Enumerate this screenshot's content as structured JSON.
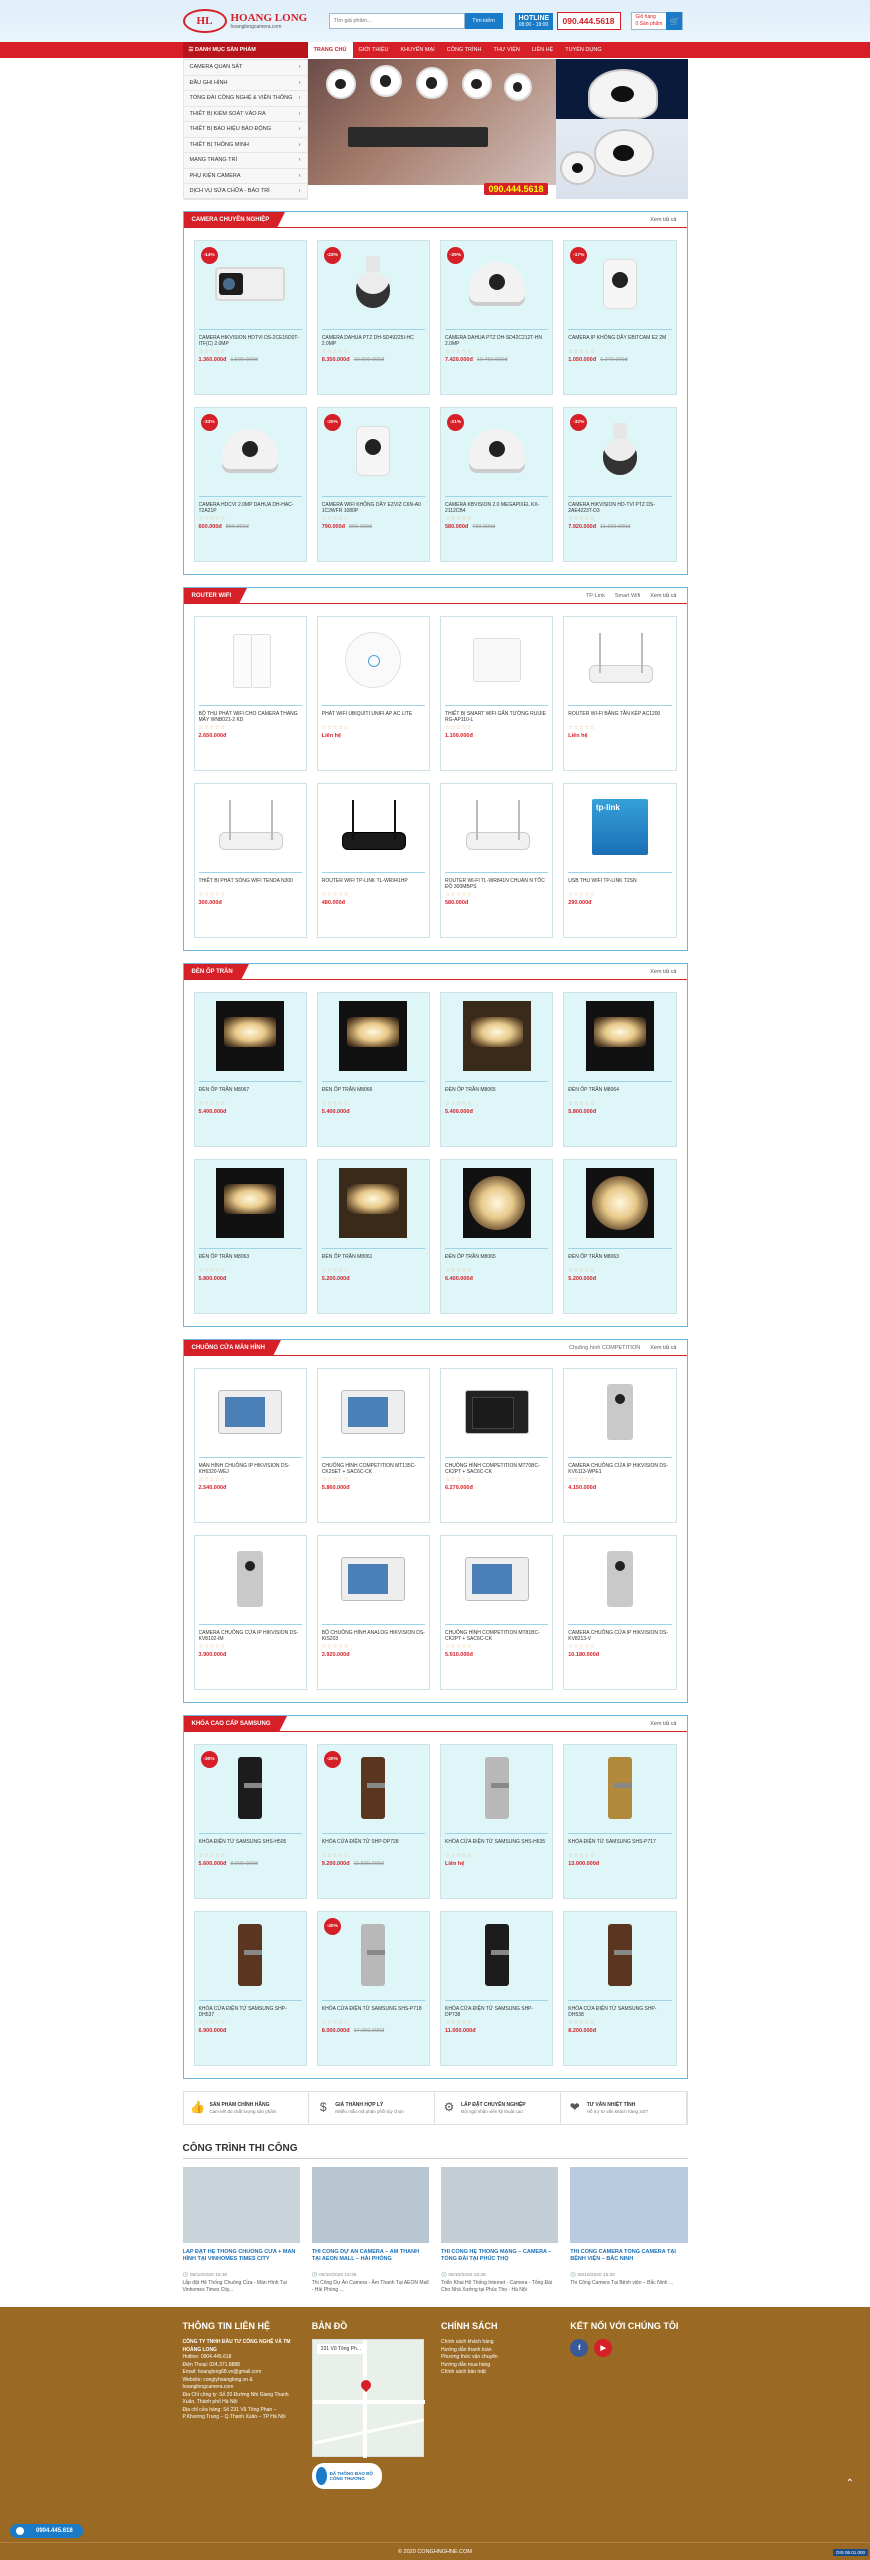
{
  "header": {
    "logo_mark": "HL",
    "logo_brand": "HOANG LONG",
    "logo_site": "hoanglongcamera.com",
    "search_placeholder": "Tìm giá phẩm...",
    "search_button": "Tìm kiếm",
    "hotline_label": "HOTLINE",
    "hotline_hours": "08:00 - 19:00",
    "phone": "090.444.5618",
    "cart_label": "Giỏ hàng",
    "cart_count": "0 Sản phẩm"
  },
  "nav": {
    "categories_button": "DANH MỤC SẢN PHẨM",
    "items": [
      "TRANG CHỦ",
      "GIỚI THIỆU",
      "KHUYẾN MẠI",
      "CÔNG TRÌNH",
      "THƯ VIỆN",
      "LIÊN HỆ",
      "TUYỂN DỤNG"
    ]
  },
  "sidebar": {
    "items": [
      "CAMERA QUAN SÁT",
      "ĐẦU GHI HÌNH",
      "TỔNG ĐÀI CÔNG NGHỆ & VIỄN THÔNG",
      "THIẾT BỊ KIỂM SOÁT VÀO RA",
      "THIẾT BỊ BÁO HIỆU BÁO ĐỘNG",
      "THIẾT BỊ THÔNG MINH",
      "MẠNG TRANG TRÍ",
      "PHỤ KIỆN CAMERA",
      "DỊCH VỤ SỬA CHỮA - BẢO TRÌ"
    ]
  },
  "hero": {
    "phone": "090.444.5618"
  },
  "sections": [
    {
      "title": "CAMERA CHUYÊN NGHIỆP",
      "links": [],
      "more": "Xem tất cả",
      "products": [
        {
          "name": "CAMERA HIKVISION HDTVI DS-2CE16D0T-ITF(C) 2.0MP",
          "price": "1.360.000đ",
          "old": "1.590.000đ",
          "sale": "-14%",
          "img": "bullet"
        },
        {
          "name": "CAMERA DAHUA PTZ DH-SD49225I-HC 2.0MP",
          "price": "8.350.000đ",
          "old": "10.900.000đ",
          "sale": "-23%",
          "img": "ptz"
        },
        {
          "name": "CAMERA DAHUA PTZ DH-SD42C212T-HN 2.0MP",
          "price": "7.420.000đ",
          "old": "10.460.000đ",
          "sale": "-29%",
          "img": "dome"
        },
        {
          "name": "CAMERA IP KHÔNG DÂY EBITCAM E2 2M",
          "price": "1.050.000đ",
          "old": "1.270.000đ",
          "sale": "-17%",
          "img": "wifi"
        },
        {
          "name": "CAMERA HDCVI 2.0MP DAHUA DH-HAC-T2A21P",
          "price": "600.000đ",
          "old": "890.000đ",
          "sale": "-33%",
          "img": "dome"
        },
        {
          "name": "CAMERA WIFI KHÔNG DÂY EZVIZ C6N-A0 1C2WFR 1080P",
          "price": "790.000đ",
          "old": "990.000đ",
          "sale": "-20%",
          "img": "wifi"
        },
        {
          "name": "CAMERA KBVISION 2.0 MEGAPIXEL KX-2112CB4",
          "price": "580.000đ",
          "old": "730.000đ",
          "sale": "-21%",
          "img": "dome"
        },
        {
          "name": "CAMERA HIKVISION HD-TVI PTZ DS-2AE4223T-D3",
          "price": "7.920.000đ",
          "old": "11.600.000đ",
          "sale": "-32%",
          "img": "ptz"
        }
      ]
    },
    {
      "title": "ROUTER WIFI",
      "links": [
        "TP-Link",
        "Smart Wifi"
      ],
      "more": "Xem tất cả",
      "products": [
        {
          "name": "BỘ THU PHÁT WIFI CHO CAMERA THANG MÁY WNB021-2 KD",
          "price": "2.650.000đ",
          "old": "",
          "sale": "",
          "img": "plug"
        },
        {
          "name": "PHÁT WIFI UBIQUITI UNIFI AP AC LITE",
          "price": "Liên hệ",
          "old": "",
          "sale": "",
          "img": "disc"
        },
        {
          "name": "THIẾT BỊ SMART WIFI GẮN TƯỜNG RUIJIE RG-AP110-L",
          "price": "1.100.000đ",
          "old": "",
          "sale": "",
          "img": "box"
        },
        {
          "name": "ROUTER WI-FI BĂNG TẦN KÉP AC1200",
          "price": "Liên hệ",
          "old": "",
          "sale": "",
          "img": "ant"
        },
        {
          "name": "THIẾT BỊ PHÁT SÓNG WIFI TENDA N300",
          "price": "300.000đ",
          "old": "",
          "sale": "",
          "img": "ant"
        },
        {
          "name": "ROUTER WIFI TP-LINK TL-WR941HP",
          "price": "480.000đ",
          "old": "",
          "sale": "",
          "img": "antdark"
        },
        {
          "name": "ROUTER WI-FI TL-WR841N CHUẨN N TỐC ĐỘ 300MBPS",
          "price": "580.000đ",
          "old": "",
          "sale": "",
          "img": "ant"
        },
        {
          "name": "USB THU WIFI TP-LINK T2SN",
          "price": "290.000đ",
          "old": "",
          "sale": "",
          "img": "usb"
        }
      ]
    },
    {
      "title": "ĐÈN ỐP TRẦN",
      "links": [],
      "more": "Xem tất cả",
      "products": [
        {
          "name": "ĐÈN ỐP TRẦN M8067",
          "price": "5.400.000đ",
          "old": "",
          "sale": "",
          "img": "lamp"
        },
        {
          "name": "ĐÈN ỐP TRẦN M8066",
          "price": "5.400.000đ",
          "old": "",
          "sale": "",
          "img": "lamp"
        },
        {
          "name": "ĐÈN ỐP TRẦN M8065",
          "price": "5.400.000đ",
          "old": "",
          "sale": "",
          "img": "lampwarm"
        },
        {
          "name": "ĐÈN ỐP TRẦN M8064",
          "price": "5.800.000đ",
          "old": "",
          "sale": "",
          "img": "lamp"
        },
        {
          "name": "ĐÈN ỐP TRẦN M8063",
          "price": "5.800.000đ",
          "old": "",
          "sale": "",
          "img": "lamp"
        },
        {
          "name": "ĐÈN ỐP TRẦN M8061",
          "price": "5.200.000đ",
          "old": "",
          "sale": "",
          "img": "lampwarm"
        },
        {
          "name": "ĐÈN ỐP TRẦN M8065",
          "price": "6.400.000đ",
          "old": "",
          "sale": "",
          "img": "lampround"
        },
        {
          "name": "ĐÈN ỐP TRẦN M8063",
          "price": "5.200.000đ",
          "old": "",
          "sale": "",
          "img": "lampround"
        }
      ]
    },
    {
      "title": "CHUÔNG CỬA MÀN HÌNH",
      "links": [
        "Chuông hình COMPETITION"
      ],
      "more": "Xem tất cả",
      "products": [
        {
          "name": "MÀN HÌNH CHUÔNG IP HIKVISION DS-KH6320-WEJ",
          "price": "2.540.000đ",
          "old": "",
          "sale": "",
          "img": "door"
        },
        {
          "name": "CHUÔNG HÌNH COMPETITION MT135C-CK2SET + SAC6C-CK",
          "price": "5.860.000đ",
          "old": "",
          "sale": "",
          "img": "doorset"
        },
        {
          "name": "CHUÔNG HÌNH COMPETITION MT70BC-CK2PT + SAC6C-CK",
          "price": "6.270.000đ",
          "old": "",
          "sale": "",
          "img": "doordark"
        },
        {
          "name": "CAMERA CHUÔNG CỬA IP HIKVISION DS-KV6113-WPE1",
          "price": "4.150.000đ",
          "old": "",
          "sale": "",
          "img": "bell"
        },
        {
          "name": "CAMERA CHUÔNG CỬA IP HIKVISION DS-KV8102-IM",
          "price": "3.900.000đ",
          "old": "",
          "sale": "",
          "img": "bell"
        },
        {
          "name": "BỘ CHUÔNG HÌNH ANALOG HIKVISION DS-KIS203",
          "price": "3.920.000đ",
          "old": "",
          "sale": "",
          "img": "doorset"
        },
        {
          "name": "CHUÔNG HÌNH COMPETITION MT81BC-CK2PT + SAC6C-CK",
          "price": "5.910.000đ",
          "old": "",
          "sale": "",
          "img": "doorset"
        },
        {
          "name": "CAMERA CHUÔNG CỬA IP HIKVISION DS-KV8213-V",
          "price": "10.180.000đ",
          "old": "",
          "sale": "",
          "img": "bell"
        }
      ]
    },
    {
      "title": "KHÓA CAO CẤP SAMSUNG",
      "links": [],
      "more": "Xem tất cả",
      "products": [
        {
          "name": "KHÓA ĐIỆN TỬ SAMSUNG SHS-H505",
          "price": "5.600.000đ",
          "old": "8.000.000đ",
          "sale": "-30%",
          "img": "lock"
        },
        {
          "name": "KHÓA CỬA ĐIỆN TỬ SHP-DP728",
          "price": "9.200.000đ",
          "old": "11.500.000đ",
          "sale": "-20%",
          "img": "lockbronze"
        },
        {
          "name": "KHÓA CỬA ĐIỆN TỬ SAMSUNG SHS-H635",
          "price": "Liên hệ",
          "old": "",
          "sale": "",
          "img": "locksilver"
        },
        {
          "name": "KHÓA ĐIỆN TỬ SAMSUNG SHS-P717",
          "price": "13.000.000đ",
          "old": "",
          "sale": "",
          "img": "lockgold"
        },
        {
          "name": "KHÓA CỬA ĐIỆN TỬ SAMSUNG SHP-DH537",
          "price": "6.900.000đ",
          "old": "",
          "sale": "",
          "img": "lockbronze"
        },
        {
          "name": "KHÓA CỬA ĐIỆN TỬ SAMSUNG SHS-P718",
          "price": "8.000.000đ",
          "old": "17.000.000đ",
          "sale": "-40%",
          "img": "locksilver"
        },
        {
          "name": "KHÓA CỬA ĐIỆN TỬ SAMSUNG SHP-DP738",
          "price": "11.000.000đ",
          "old": "",
          "sale": "",
          "img": "lock"
        },
        {
          "name": "KHÓA CỬA ĐIỆN TỬ SAMSUNG SHP-DH538",
          "price": "8.200.000đ",
          "old": "",
          "sale": "",
          "img": "lockbronze"
        }
      ]
    }
  ],
  "features": [
    {
      "title": "SẢN PHẨM CHÍNH HÃNG",
      "desc": "Cam kết đủ chất lượng sản phẩm",
      "icon": "thumb-icon",
      "glyph": "👍"
    },
    {
      "title": "GIÁ THÀNH HỢP LÝ",
      "desc": "Nhiều mẫu mã phân phối tùy chọn",
      "icon": "dollar-icon",
      "glyph": "$"
    },
    {
      "title": "LẮP ĐẶT CHUYÊN NGHIỆP",
      "desc": "Đội ngũ nhân viên kỹ thuật cao",
      "icon": "gear-icon",
      "glyph": "⚙"
    },
    {
      "title": "TƯ VẤN NHIỆT TÌNH",
      "desc": "Hỗ trợ tư vấn khách hàng 24/7",
      "icon": "handshake-icon",
      "glyph": "❤"
    }
  ],
  "projects": {
    "title": "CÔNG TRÌNH THI CÔNG",
    "items": [
      {
        "title": "LẮP ĐẶT HỆ THỐNG CHUÔNG CỬA + MÀN HÌNH TẠI VINHOMES TIMES CITY",
        "date": "05/10/2020 15:30",
        "excerpt": "Lắp đặt Hệ Thống Chuông Cửa - Màn Hình Tại Vinhomes Times City..."
      },
      {
        "title": "THI CÔNG DỰ ÁN CAMERA – ÂM THANH TẠI AEON MALL – HẢI PHÒNG",
        "date": "05/10/2020 15:25",
        "excerpt": "Thi Công Dự Án Camera - Âm Thanh Tại AEON Mall - Hải Phòng ..."
      },
      {
        "title": "THI CÔNG HỆ THỐNG MẠNG – CAMERA – TỔNG ĐÀI TẠI PHÚC THỌ",
        "date": "05/10/2020 15:25",
        "excerpt": "Triển Khai Hệ Thống Internet - Camera - Tổng Đài Cho Nhà Xưởng tại Phúc Thọ - Hà Nội"
      },
      {
        "title": "THI CÔNG CAMERA TỔNG CAMERA TẠI BỆNH VIỆN – BẮC NINH",
        "date": "05/10/2020 15:20",
        "excerpt": "Thi Công Camera Tại Bệnh viện – Bắc Ninh ..."
      }
    ]
  },
  "footer": {
    "contact_title": "THÔNG TIN LIÊN HỆ",
    "company": "CÔNG TY TNHH ĐẦU TƯ CÔNG NGHỆ VÀ TM HOÀNG LONG",
    "lines": [
      "Hotline: 0904.445.618",
      "Điện Thoại: 024.371.8888",
      "Email: hoanglong68.vn@gmail.com",
      "Website: congtyhoanglong.vn & hoanglongcamera.com",
      "Địa Chỉ công ty: Số 20 Đường Nhi Giang Thanh Xuân, Thành phố Hà Nội",
      "Địa chỉ cửa hàng: Số 231 Vũ Tông Phan – P.Khương Trung – Q.Thanh Xuân – TP Hà Nội"
    ],
    "map_title": "BẢN ĐỒ",
    "map_label": "231 Vũ Tông Ph...",
    "policy_title": "CHÍNH SÁCH",
    "policies": [
      "Chính sách khách hàng",
      "Hướng dẫn thanh toán",
      "Phương thức vận chuyển",
      "Hướng dẫn mua hàng",
      "Chính sách bảo mật"
    ],
    "social_title": "KẾT NỐI VỚI CHÚNG TÔI",
    "social": [
      {
        "label": "f",
        "color": "#3b5998"
      },
      {
        "label": "▶",
        "color": "#d61f26"
      }
    ],
    "bct": "ĐÃ THÔNG BÁO BỘ CÔNG THƯƠNG",
    "copyright": "© 2020 CONGHNGHNE.COM",
    "fixed_phone": "0904.445.618",
    "corner_badge": "DIS 06.01.000"
  }
}
